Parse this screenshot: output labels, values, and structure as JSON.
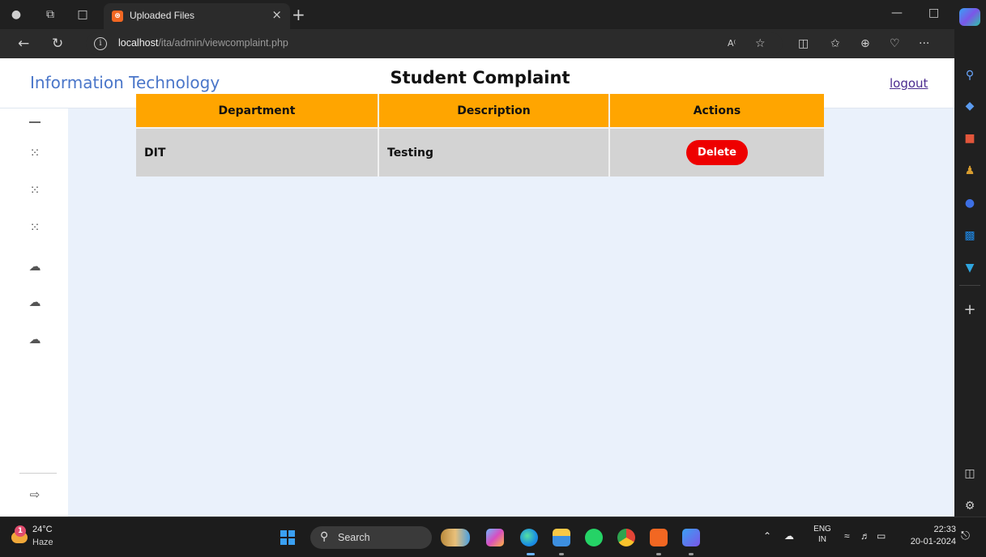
{
  "browser": {
    "tab_title": "Uploaded Files",
    "url_host": "localhost",
    "url_path": "/ita/admin/viewcomplaint.php",
    "accent": "#4a76c9"
  },
  "page": {
    "brand": "Information Technology",
    "logout_label": "logout",
    "title": "Student Complaint",
    "table": {
      "headers": [
        "Department",
        "Description",
        "Actions"
      ],
      "rows": [
        {
          "department": "DIT",
          "description": "Testing",
          "action_label": "Delete"
        }
      ]
    },
    "colors": {
      "header_bg": "#ffa500",
      "row_bg": "#d3d3d3",
      "delete_bg": "#ee0000",
      "page_bg": "#eaf1fb"
    }
  },
  "taskbar": {
    "weather_temp": "24°C",
    "weather_cond": "Haze",
    "weather_badge": "1",
    "search_label": "Search",
    "lang_line1": "ENG",
    "lang_line2": "IN",
    "time": "22:33",
    "date": "20-01-2024"
  }
}
